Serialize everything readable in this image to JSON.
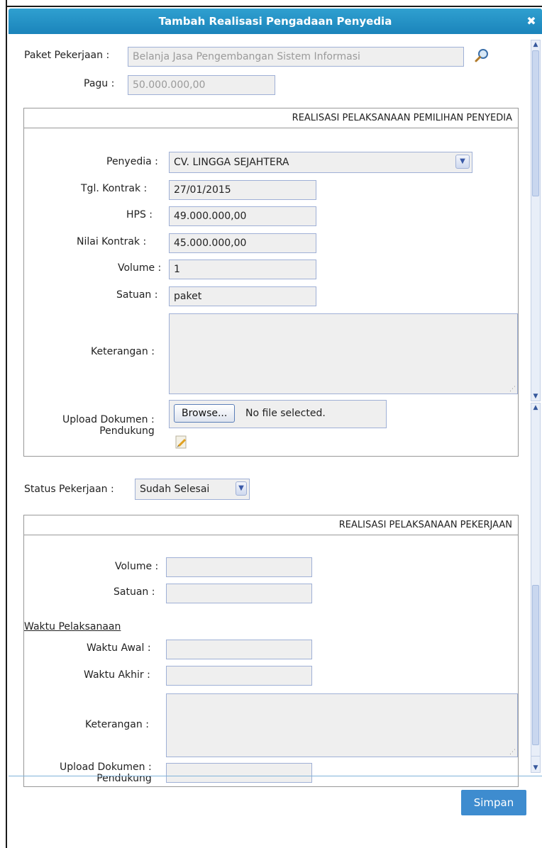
{
  "dialog": {
    "title": "Tambah Realisasi Pengadaan Penyedia",
    "close_symbol": "✖"
  },
  "top": {
    "paket_label": "Paket Pekerjaan",
    "paket_value": "Belanja Jasa Pengembangan Sistem Informasi",
    "pagu_label": "Pagu",
    "pagu_value": "50.000.000,00",
    "search_icon": "search-icon"
  },
  "pemilihan": {
    "heading": "REALISASI PELAKSANAAN PEMILIHAN PENYEDIA",
    "penyedia_label": "Penyedia",
    "penyedia_value": "CV. LINGGA SEJAHTERA",
    "tgl_kontrak_label": "Tgl. Kontrak",
    "tgl_kontrak_value": "27/01/2015",
    "hps_label": "HPS",
    "hps_value": "49.000.000,00",
    "nilai_kontrak_label": "Nilai Kontrak",
    "nilai_kontrak_value": "45.000.000,00",
    "volume_label": "Volume",
    "volume_value": "1",
    "satuan_label": "Satuan",
    "satuan_value": "paket",
    "keterangan_label": "Keterangan",
    "keterangan_value": "",
    "upload_label_1": "Upload Dokumen",
    "upload_label_2": "Pendukung",
    "browse_label": "Browse...",
    "no_file_text": "No file selected.",
    "edit_icon": "edit-icon"
  },
  "status": {
    "label": "Status Pekerjaan",
    "value": "Sudah Selesai"
  },
  "pelaksanaan": {
    "heading": "REALISASI PELAKSANAAN PEKERJAAN",
    "volume_label": "Volume",
    "satuan_label": "Satuan",
    "waktu_heading": "Waktu Pelaksanaan",
    "waktu_awal_label": "Waktu Awal",
    "waktu_akhir_label": "Waktu Akhir",
    "keterangan_label": "Keterangan",
    "upload_label_1": "Upload Dokumen",
    "upload_label_2": "Pendukung"
  },
  "footer": {
    "save_label": "Simpan"
  },
  "colors": {
    "titlebar": "#1b84bb",
    "save_button": "#3e8ccf",
    "field_bg": "#efefef",
    "field_border": "#9fb0d6"
  }
}
